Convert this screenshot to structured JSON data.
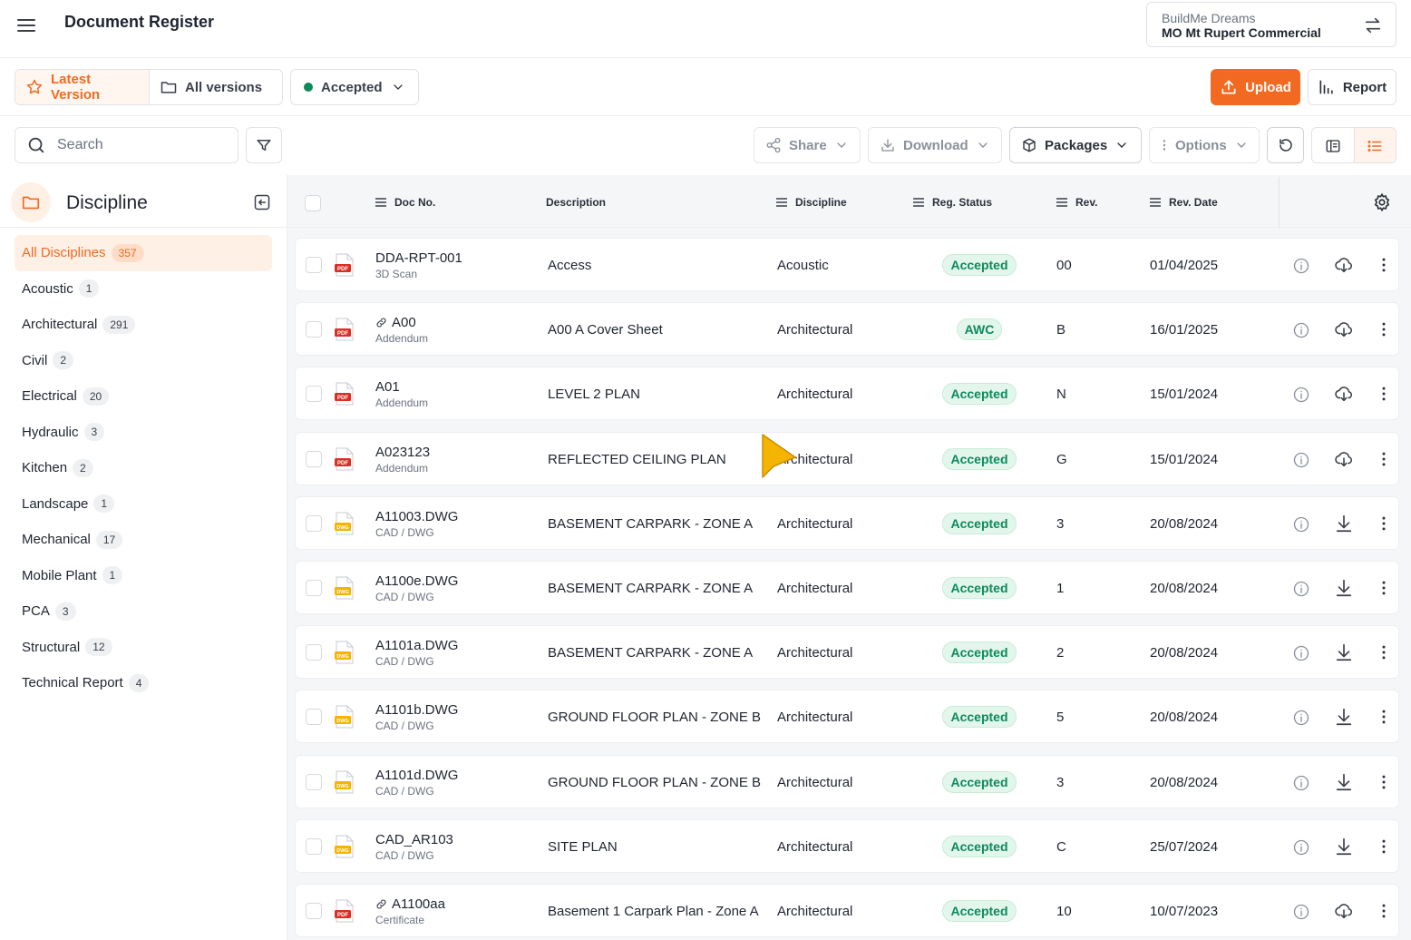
{
  "header": {
    "title": "Document Register",
    "project_company": "BuildMe Dreams",
    "project_name": "MO Mt Rupert Commercial"
  },
  "toolbar": {
    "latest_version_label": "Latest Version",
    "all_versions_label": "All versions",
    "status_filter_label": "Accepted",
    "upload_label": "Upload",
    "report_label": "Report",
    "search_placeholder": "Search",
    "share_label": "Share",
    "download_label": "Download",
    "packages_label": "Packages",
    "options_label": "Options"
  },
  "colors": {
    "accent": "#f26a22",
    "accepted_green": "#0d8a5b",
    "pdf_red": "#d93025",
    "dwg_yellow": "#f5b400"
  },
  "sidebar": {
    "title": "Discipline",
    "items": [
      {
        "label": "All Disciplines",
        "count": "357",
        "active": true
      },
      {
        "label": "Acoustic",
        "count": "1"
      },
      {
        "label": "Architectural",
        "count": "291"
      },
      {
        "label": "Civil",
        "count": "2"
      },
      {
        "label": "Electrical",
        "count": "20"
      },
      {
        "label": "Hydraulic",
        "count": "3"
      },
      {
        "label": "Kitchen",
        "count": "2"
      },
      {
        "label": "Landscape",
        "count": "1"
      },
      {
        "label": "Mechanical",
        "count": "17"
      },
      {
        "label": "Mobile Plant",
        "count": "1"
      },
      {
        "label": "PCA",
        "count": "3"
      },
      {
        "label": "Structural",
        "count": "12"
      },
      {
        "label": "Technical Report",
        "count": "4"
      }
    ]
  },
  "table": {
    "columns": {
      "doc_no": "Doc No.",
      "description": "Description",
      "discipline": "Discipline",
      "reg_status": "Reg. Status",
      "rev": "Rev.",
      "rev_date": "Rev. Date"
    },
    "rows": [
      {
        "doc_no": "DDA-RPT-001",
        "sub": "3D Scan",
        "file": "PDF",
        "link": false,
        "description": "Access",
        "discipline": "Acoustic",
        "status": "Accepted",
        "rev": "00",
        "rev_date": "01/04/2025",
        "download_icon": "cloud-download-icon"
      },
      {
        "doc_no": "A00",
        "sub": "Addendum",
        "file": "PDF",
        "link": true,
        "description": "A00 A Cover Sheet",
        "discipline": "Architectural",
        "status": "AWC",
        "rev": "B",
        "rev_date": "16/01/2025",
        "download_icon": "cloud-download-icon"
      },
      {
        "doc_no": "A01",
        "sub": "Addendum",
        "file": "PDF",
        "link": false,
        "description": "LEVEL 2 PLAN",
        "discipline": "Architectural",
        "status": "Accepted",
        "rev": "N",
        "rev_date": "15/01/2024",
        "download_icon": "cloud-download-icon"
      },
      {
        "doc_no": "A023123",
        "sub": "Addendum",
        "file": "PDF",
        "link": false,
        "description": "REFLECTED CEILING PLAN",
        "discipline": "Architectural",
        "status": "Accepted",
        "rev": "G",
        "rev_date": "15/01/2024",
        "download_icon": "cloud-download-icon"
      },
      {
        "doc_no": "A11003.DWG",
        "sub": "CAD / DWG",
        "file": "DWG",
        "link": false,
        "description": "BASEMENT CARPARK - ZONE A",
        "discipline": "Architectural",
        "status": "Accepted",
        "rev": "3",
        "rev_date": "20/08/2024",
        "download_icon": "download-icon"
      },
      {
        "doc_no": "A1100e.DWG",
        "sub": "CAD / DWG",
        "file": "DWG",
        "link": false,
        "description": "BASEMENT CARPARK - ZONE A",
        "discipline": "Architectural",
        "status": "Accepted",
        "rev": "1",
        "rev_date": "20/08/2024",
        "download_icon": "download-icon"
      },
      {
        "doc_no": "A1101a.DWG",
        "sub": "CAD / DWG",
        "file": "DWG",
        "link": false,
        "description": "BASEMENT CARPARK - ZONE A",
        "discipline": "Architectural",
        "status": "Accepted",
        "rev": "2",
        "rev_date": "20/08/2024",
        "download_icon": "download-icon"
      },
      {
        "doc_no": "A1101b.DWG",
        "sub": "CAD / DWG",
        "file": "DWG",
        "link": false,
        "description": "GROUND FLOOR PLAN - ZONE  B",
        "discipline": "Architectural",
        "status": "Accepted",
        "rev": "5",
        "rev_date": "20/08/2024",
        "download_icon": "download-icon"
      },
      {
        "doc_no": "A1101d.DWG",
        "sub": "CAD / DWG",
        "file": "DWG",
        "link": false,
        "description": "GROUND FLOOR PLAN - ZONE  B",
        "discipline": "Architectural",
        "status": "Accepted",
        "rev": "3",
        "rev_date": "20/08/2024",
        "download_icon": "download-icon"
      },
      {
        "doc_no": "CAD_AR103",
        "sub": "CAD / DWG",
        "file": "DWG",
        "link": false,
        "description": "SITE PLAN",
        "discipline": "Architectural",
        "status": "Accepted",
        "rev": "C",
        "rev_date": "25/07/2024",
        "download_icon": "download-icon"
      },
      {
        "doc_no": "A1100aa",
        "sub": "Certificate",
        "file": "PDF",
        "link": true,
        "description": "Basement 1 Carpark Plan - Zone A",
        "discipline": "Architectural",
        "status": "Accepted",
        "rev": "10",
        "rev_date": "10/07/2023",
        "download_icon": "cloud-download-icon"
      }
    ]
  }
}
